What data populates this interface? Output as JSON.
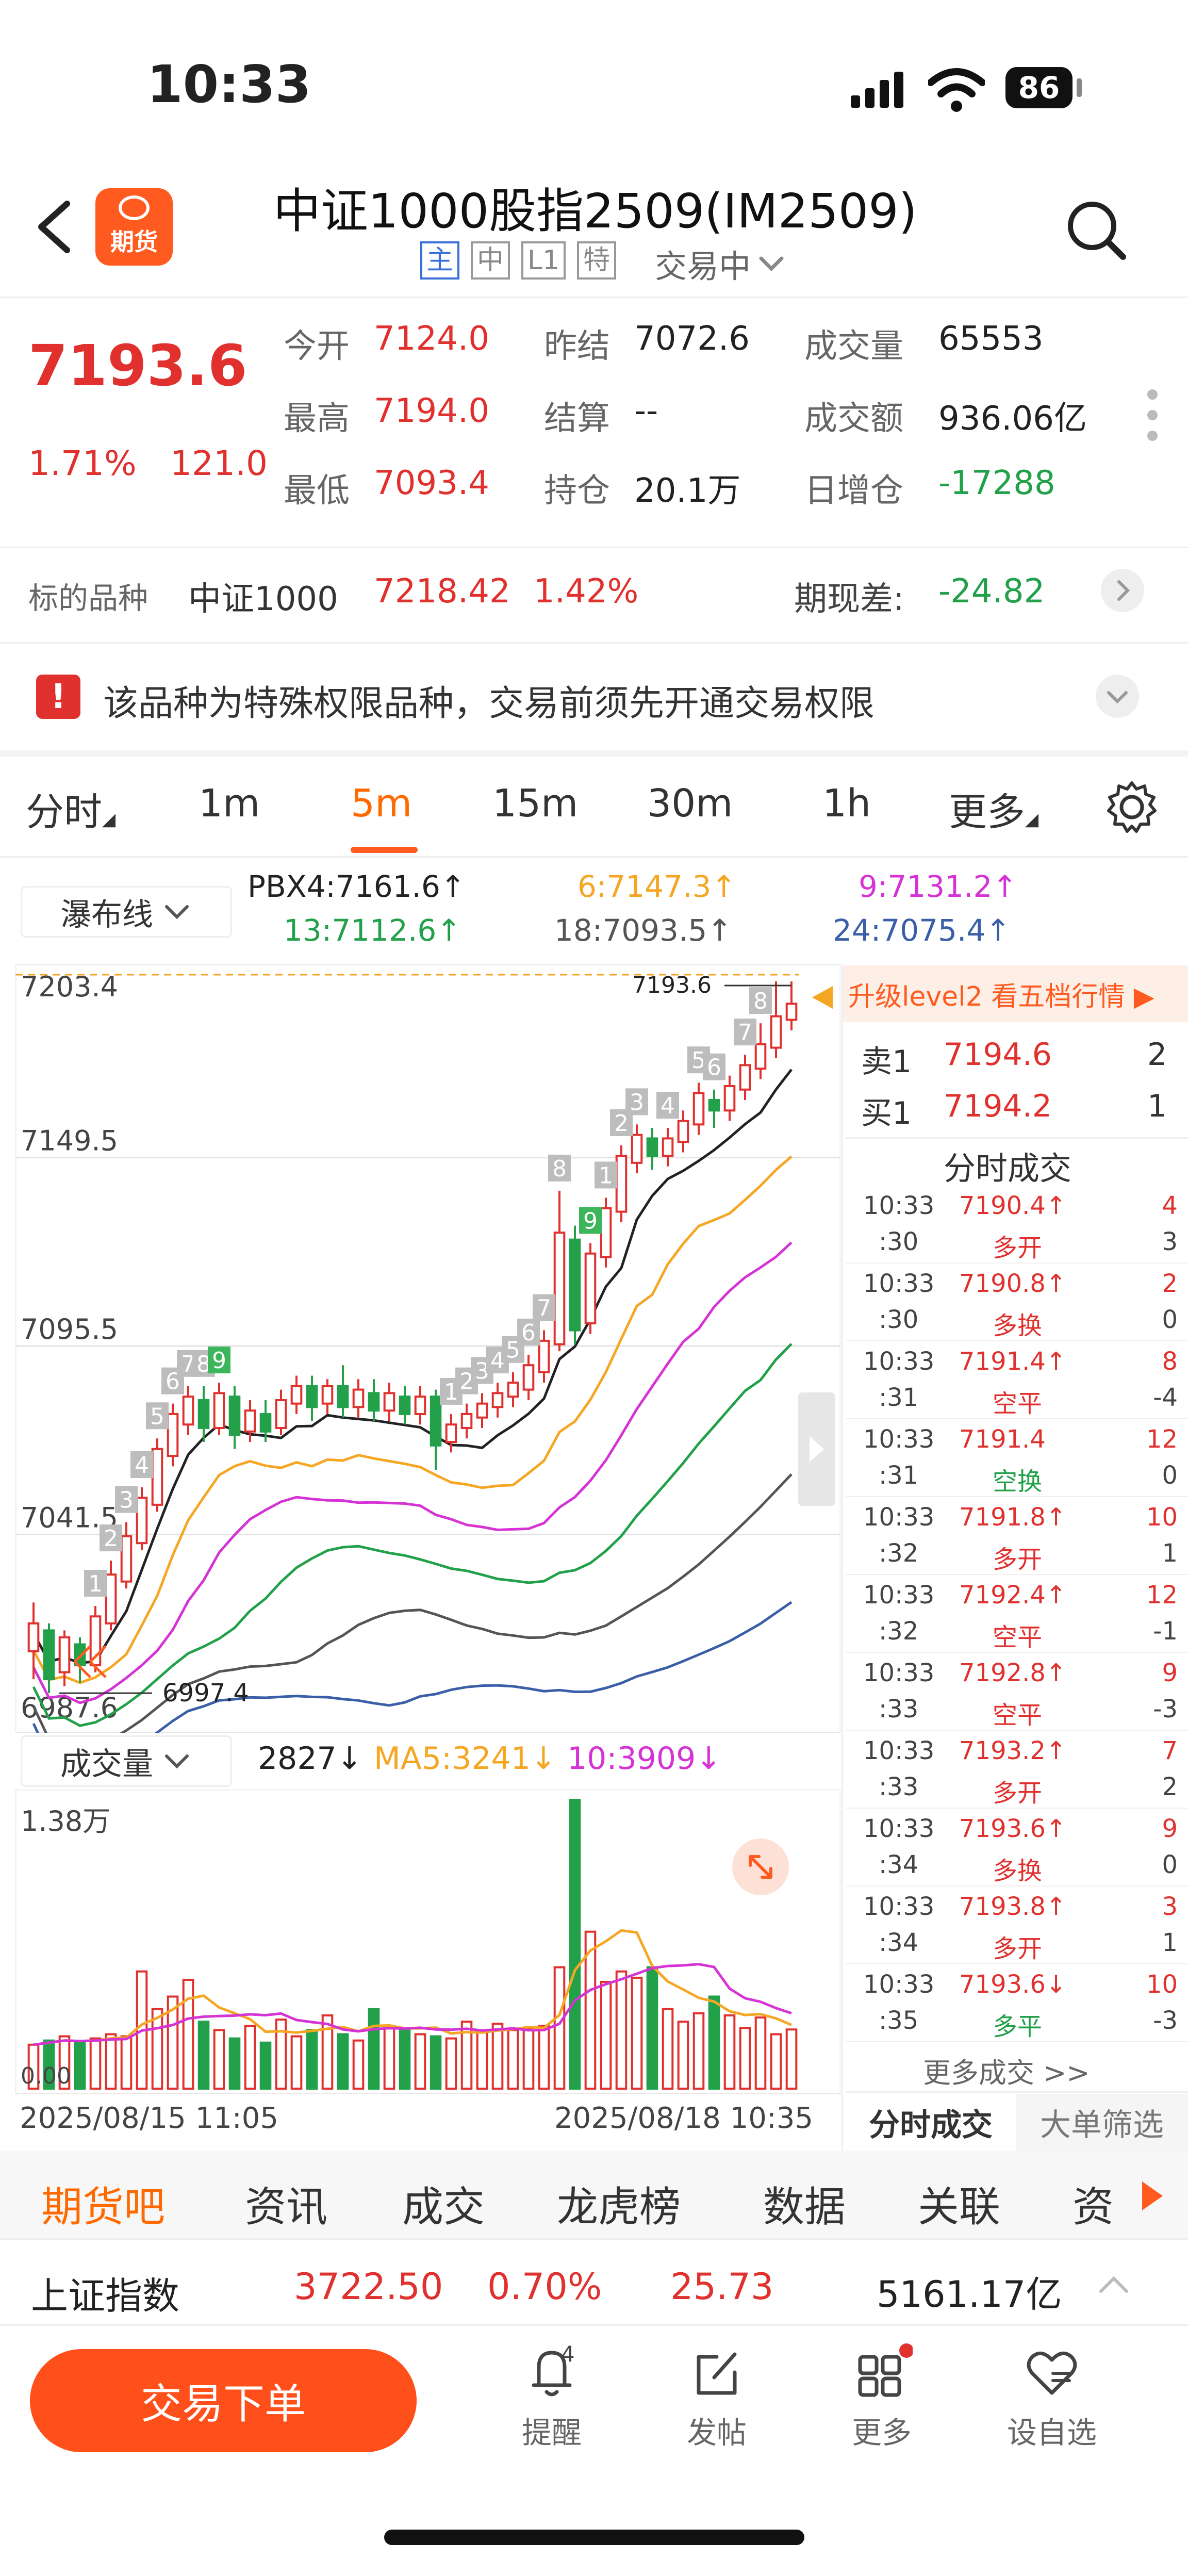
{
  "status_bar": {
    "time": "10:33",
    "battery": "86"
  },
  "header": {
    "logo_text": "期货",
    "title": "中证1000股指2509(IM2509)",
    "tags": [
      "主",
      "中",
      "L1",
      "特"
    ],
    "trade_status": "交易中"
  },
  "quote": {
    "price": "7193.6",
    "change_pct": "1.71%",
    "change": "121.0",
    "stats": [
      [
        {
          "label": "今开",
          "value": "7124.0",
          "color": "red"
        },
        {
          "label": "昨结",
          "value": "7072.6",
          "color": "dark"
        },
        {
          "label": "成交量",
          "value": "65553",
          "color": "dark"
        }
      ],
      [
        {
          "label": "最高",
          "value": "7194.0",
          "color": "red"
        },
        {
          "label": "结算",
          "value": "--",
          "color": "dark"
        },
        {
          "label": "成交额",
          "value": "936.06亿",
          "color": "dark"
        }
      ],
      [
        {
          "label": "最低",
          "value": "7093.4",
          "color": "red"
        },
        {
          "label": "持仓",
          "value": "20.1万",
          "color": "dark"
        },
        {
          "label": "日增仓",
          "value": "-17288",
          "color": "green"
        }
      ]
    ]
  },
  "underlying": {
    "label": "标的品种",
    "name": "中证1000",
    "price": "7218.42",
    "pct": "1.42%",
    "basis_label": "期现差:",
    "basis": "-24.82"
  },
  "notice": {
    "text": "该品种为特殊权限品种，交易前须先开通交易权限"
  },
  "period_tabs": [
    "分时",
    "1m",
    "5m",
    "15m",
    "30m",
    "1h",
    "更多"
  ],
  "active_tab": "5m",
  "indicator": {
    "selector": "瀑布线",
    "values": [
      {
        "text": "PBX4:7161.6↑",
        "color": "#222222"
      },
      {
        "text": "6:7147.3↑",
        "color": "#f5a623"
      },
      {
        "text": "9:7131.2↑",
        "color": "#d633d6"
      },
      {
        "text": "13:7112.6↑",
        "color": "#22a04a"
      },
      {
        "text": "18:7093.5↑",
        "color": "#555555"
      },
      {
        "text": "24:7075.4↑",
        "color": "#3a5ea8"
      }
    ]
  },
  "chart_data": {
    "type": "candlestick",
    "y_ticks": [
      "7203.4",
      "7149.5",
      "7095.5",
      "7041.5",
      "6987.6"
    ],
    "ylim": [
      6987.6,
      7203.4
    ],
    "current_label": "7193.6",
    "low_label": "6997.4",
    "x_start": "2025/08/15 11:05",
    "x_end": "2025/08/18 10:35",
    "candles": [
      [
        7008,
        7016,
        7000,
        7022
      ],
      [
        7014,
        7000,
        6996,
        7016
      ],
      [
        7002,
        7012,
        6998,
        7014
      ],
      [
        7010,
        7004,
        6999,
        7012
      ],
      [
        7004,
        7018,
        7002,
        7021
      ],
      [
        7016,
        7030,
        7014,
        7034
      ],
      [
        7028,
        7041,
        7026,
        7045
      ],
      [
        7039,
        7052,
        7037,
        7055
      ],
      [
        7050,
        7066,
        7048,
        7069
      ],
      [
        7064,
        7076,
        7061,
        7079
      ],
      [
        7073,
        7081,
        7070,
        7084
      ],
      [
        7080,
        7072,
        7068,
        7084
      ],
      [
        7072,
        7082,
        7070,
        7085
      ],
      [
        7081,
        7070,
        7066,
        7084
      ],
      [
        7071,
        7077,
        7068,
        7080
      ],
      [
        7076,
        7071,
        7068,
        7080
      ],
      [
        7072,
        7080,
        7070,
        7083
      ],
      [
        7079,
        7084,
        7076,
        7087
      ],
      [
        7084,
        7078,
        7074,
        7087
      ],
      [
        7079,
        7084,
        7076,
        7086
      ],
      [
        7084,
        7078,
        7075,
        7090
      ],
      [
        7078,
        7083,
        7075,
        7086
      ],
      [
        7082,
        7077,
        7074,
        7086
      ],
      [
        7077,
        7082,
        7074,
        7085
      ],
      [
        7081,
        7076,
        7073,
        7084
      ],
      [
        7076,
        7081,
        7073,
        7084
      ],
      [
        7081,
        7067,
        7060,
        7083
      ],
      [
        7068,
        7073,
        7065,
        7076
      ],
      [
        7072,
        7076,
        7069,
        7079
      ],
      [
        7075,
        7079,
        7072,
        7082
      ],
      [
        7078,
        7082,
        7075,
        7085
      ],
      [
        7081,
        7085,
        7078,
        7088
      ],
      [
        7083,
        7090,
        7080,
        7093
      ],
      [
        7088,
        7097,
        7085,
        7100
      ],
      [
        7096,
        7128,
        7094,
        7140
      ],
      [
        7126,
        7100,
        7096,
        7130
      ],
      [
        7102,
        7122,
        7099,
        7125
      ],
      [
        7121,
        7135,
        7118,
        7138
      ],
      [
        7134,
        7150,
        7131,
        7153
      ],
      [
        7148,
        7156,
        7145,
        7159
      ],
      [
        7155,
        7150,
        7146,
        7158
      ],
      [
        7150,
        7155,
        7147,
        7158
      ],
      [
        7154,
        7160,
        7151,
        7163
      ],
      [
        7159,
        7168,
        7156,
        7171
      ],
      [
        7166,
        7163,
        7158,
        7169
      ],
      [
        7163,
        7170,
        7160,
        7173
      ],
      [
        7169,
        7176,
        7166,
        7179
      ],
      [
        7175,
        7182,
        7172,
        7188
      ],
      [
        7181,
        7190,
        7178,
        7200
      ],
      [
        7189,
        7193.6,
        7186,
        7200
      ]
    ],
    "seq_labels": [
      {
        "i": 4,
        "t": "1",
        "c": "gray"
      },
      {
        "i": 5,
        "t": "2",
        "c": "gray"
      },
      {
        "i": 6,
        "t": "3",
        "c": "gray"
      },
      {
        "i": 7,
        "t": "4",
        "c": "gray"
      },
      {
        "i": 8,
        "t": "5",
        "c": "gray"
      },
      {
        "i": 9,
        "t": "6",
        "c": "gray"
      },
      {
        "i": 10,
        "t": "7",
        "c": "gray"
      },
      {
        "i": 11,
        "t": "8",
        "c": "gray"
      },
      {
        "i": 12,
        "t": "9",
        "c": "green"
      },
      {
        "i": 27,
        "t": "1",
        "c": "gray"
      },
      {
        "i": 28,
        "t": "2",
        "c": "gray"
      },
      {
        "i": 29,
        "t": "3",
        "c": "gray"
      },
      {
        "i": 30,
        "t": "4",
        "c": "gray"
      },
      {
        "i": 31,
        "t": "5",
        "c": "gray"
      },
      {
        "i": 32,
        "t": "6",
        "c": "gray"
      },
      {
        "i": 33,
        "t": "7",
        "c": "gray"
      },
      {
        "i": 34,
        "t": "8",
        "c": "gray"
      },
      {
        "i": 36,
        "t": "9",
        "c": "green"
      },
      {
        "i": 37,
        "t": "1",
        "c": "gray"
      },
      {
        "i": 38,
        "t": "2",
        "c": "gray"
      },
      {
        "i": 39,
        "t": "3",
        "c": "gray"
      },
      {
        "i": 41,
        "t": "4",
        "c": "gray"
      },
      {
        "i": 43,
        "t": "5",
        "c": "gray"
      },
      {
        "i": 44,
        "t": "6",
        "c": "gray"
      },
      {
        "i": 46,
        "t": "7",
        "c": "gray"
      },
      {
        "i": 47,
        "t": "8",
        "c": "gray"
      }
    ],
    "ma_lines": [
      {
        "color": "#222222",
        "offset": -8
      },
      {
        "color": "#f5a623",
        "offset": -22
      },
      {
        "color": "#d633d6",
        "offset": -36
      },
      {
        "color": "#22a04a",
        "offset": -52
      },
      {
        "color": "#555555",
        "offset": -68
      },
      {
        "color": "#3a5ea8",
        "offset": -82
      }
    ]
  },
  "volume": {
    "selector": "成交量",
    "current": "2827↓",
    "ma5": "MA5:3241↓",
    "ma10": "10:3909↓",
    "max_label": "1.38万",
    "min_label": "0.00",
    "bars": [
      2100,
      2300,
      2500,
      2200,
      2400,
      2600,
      2500,
      5600,
      3800,
      4400,
      5200,
      3200,
      2800,
      2400,
      3000,
      2200,
      3300,
      2500,
      2800,
      3500,
      2600,
      2300,
      3800,
      2900,
      2800,
      2600,
      2500,
      2400,
      3200,
      2700,
      3100,
      2800,
      2900,
      3000,
      5800,
      13800,
      7500,
      5100,
      5600,
      5300,
      5800,
      3800,
      3200,
      3600,
      4400,
      3500,
      2900,
      3400,
      2600,
      2827
    ]
  },
  "order_book": {
    "banner": "升级level2 看五档行情 ▶",
    "sell": {
      "label": "卖1",
      "price": "7194.6",
      "qty": "2"
    },
    "buy": {
      "label": "买1",
      "price": "7194.2",
      "qty": "1"
    },
    "trades_title": "分时成交",
    "trades": [
      {
        "t1": "10:33",
        "t2": ":30",
        "price": "7190.4↑",
        "pc": "red",
        "type": "多开",
        "tc": "red",
        "qty": "4",
        "d": "3",
        "dc": "red"
      },
      {
        "t1": "10:33",
        "t2": ":30",
        "price": "7190.8↑",
        "pc": "red",
        "type": "多换",
        "tc": "red",
        "qty": "2",
        "d": "0",
        "dc": "dark"
      },
      {
        "t1": "10:33",
        "t2": ":31",
        "price": "7191.4↑",
        "pc": "red",
        "type": "空平",
        "tc": "red",
        "qty": "8",
        "d": "-4",
        "dc": "dark"
      },
      {
        "t1": "10:33",
        "t2": ":31",
        "price": "7191.4",
        "pc": "red",
        "type": "空换",
        "tc": "green",
        "qty": "12",
        "d": "0",
        "dc": "dark"
      },
      {
        "t1": "10:33",
        "t2": ":32",
        "price": "7191.8↑",
        "pc": "red",
        "type": "多开",
        "tc": "red",
        "qty": "10",
        "d": "1",
        "dc": "dark"
      },
      {
        "t1": "10:33",
        "t2": ":32",
        "price": "7192.4↑",
        "pc": "red",
        "type": "空平",
        "tc": "red",
        "qty": "12",
        "d": "-1",
        "dc": "dark"
      },
      {
        "t1": "10:33",
        "t2": ":33",
        "price": "7192.8↑",
        "pc": "red",
        "type": "空平",
        "tc": "red",
        "qty": "9",
        "d": "-3",
        "dc": "dark"
      },
      {
        "t1": "10:33",
        "t2": ":33",
        "price": "7193.2↑",
        "pc": "red",
        "type": "多开",
        "tc": "red",
        "qty": "7",
        "d": "2",
        "dc": "dark"
      },
      {
        "t1": "10:33",
        "t2": ":34",
        "price": "7193.6↑",
        "pc": "red",
        "type": "多换",
        "tc": "red",
        "qty": "9",
        "d": "0",
        "dc": "dark"
      },
      {
        "t1": "10:33",
        "t2": ":34",
        "price": "7193.8↑",
        "pc": "red",
        "type": "多开",
        "tc": "red",
        "qty": "3",
        "d": "1",
        "dc": "dark"
      },
      {
        "t1": "10:33",
        "t2": ":35",
        "price": "7193.6↓",
        "pc": "red",
        "type": "多平",
        "tc": "green",
        "qty": "10",
        "d": "-3",
        "dc": "dark"
      }
    ],
    "more_trades": "更多成交 >>",
    "tab_active": "分时成交",
    "tab_other": "大单筛选"
  },
  "bottom_tabs": [
    "期货吧",
    "资讯",
    "成交",
    "龙虎榜",
    "数据",
    "关联",
    "资"
  ],
  "index_bar": {
    "name": "上证指数",
    "price": "3722.50",
    "pct": "0.70%",
    "change": "25.73",
    "amount": "5161.17亿"
  },
  "action_bar": {
    "trade_button": "交易下单",
    "items": [
      {
        "label": "提醒",
        "badge": "4"
      },
      {
        "label": "发帖"
      },
      {
        "label": "更多"
      },
      {
        "label": "设自选"
      }
    ]
  }
}
